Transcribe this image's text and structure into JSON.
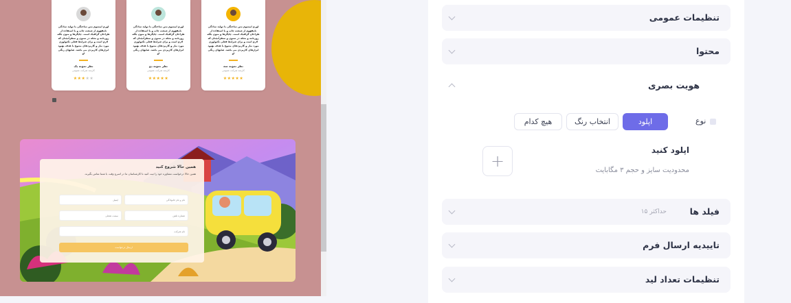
{
  "preview": {
    "cards": [
      {
        "text": "لورم ایپسوم متن ساختگی با تولید سادگی نامفهوم از صنعت چاپ و با استفاده از طراحان گرافیک است. چاپگرها و متون بلکه روزنامه و مجله در ستون و سطرآنچنان که لازم است و برای شرایط فعلی تکنولوژی مورد نیاز و کاربردهای متنوع با هدف بهبود ابزارهای کاربردی می باشد. شاپهای رنگی او",
        "name": "نظر نمونه یک",
        "role": "کارمند شرکت عمومی",
        "stars": "★★★★★"
      },
      {
        "text": "لورم ایپسوم متن ساختگی با تولید سادگی نامفهوم از صنعت چاپ و با استفاده از طراحان گرافیک است. چاپگرها و متون بلکه روزنامه و مجله در ستون و سطرآنچنان که لازم است و برای شرایط فعلی تکنولوژی مورد نیاز و کاربردهای متنوع با هدف بهبود ابزارهای کاربردی می باشد. شاپهای رنگی او",
        "name": "نظر نمونه دو",
        "role": "کارمند شرکت عمومی",
        "stars": "★★★★★"
      },
      {
        "text": "لورم ایپسوم متن ساختگی با تولید سادگی نامفهوم از صنعت چاپ و با استفاده از طراحان گرافیک است. چاپگرها و متون بلکه روزنامه و مجله در ستون و سطرآنچنان که لازم است و برای شرایط فعلی تکنولوژی مورد نیاز و کاربردهای متنوع با هدف بهبود ابزارهای کاربردی می باشد. شاپهای رنگی او",
        "name": "نظر نمونه سه",
        "role": "کارمند شرکت عمومی",
        "stars": "★★★★★"
      }
    ],
    "form": {
      "title": "همین حالا شروع کنید",
      "desc": "همین حالا درخواست مشاوره خود را ثبت کنید تا کارشناسان ما در اسرع وقت با شما تماس بگیرند.",
      "fields": [
        "نام و نام خانوادگی",
        "ایمیل",
        "شماره تلفن",
        "سمت شغلی",
        "نام شرکت"
      ],
      "submit": "ارسال درخواست"
    }
  },
  "settings": {
    "general": "تنظیمات عمومی",
    "content": "محتوا",
    "visual": "هویت بصری",
    "type_label": "نوع",
    "type_options": [
      "اپلود",
      "انتخاب رنگ",
      "هیچ کدام"
    ],
    "upload_title": "اپلود کنید",
    "upload_note": "محدودیت سایز و حجم ۳ مگابایت",
    "fields": "فیلد ها",
    "fields_sub": "حداکثر ۱۵",
    "confirm": "تاییدیه ارسال فرم",
    "lead": "تنظیمات تعداد لید"
  },
  "colors": {
    "accent": "#6e6ce8",
    "preview_bg": "#c79191",
    "circle": "#e8b508"
  }
}
